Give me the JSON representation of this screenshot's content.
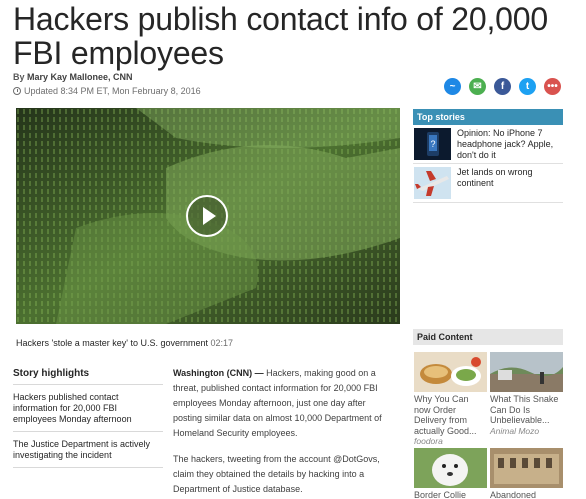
{
  "article": {
    "headline": "Hackers publish contact info of 20,000 FBI employees",
    "byline_prefix": "By ",
    "author": "Mary Kay Mallonee, CNN",
    "updated": "Updated 8:34 PM ET, Mon February 8, 2016"
  },
  "share": [
    {
      "icon": "messenger-icon",
      "glyph": "~",
      "color": "#1e88e5"
    },
    {
      "icon": "email-icon",
      "glyph": "✉",
      "color": "#4caf50"
    },
    {
      "icon": "facebook-icon",
      "glyph": "f",
      "color": "#3b5998"
    },
    {
      "icon": "twitter-icon",
      "glyph": "t",
      "color": "#1da1f2"
    },
    {
      "icon": "more-icon",
      "glyph": "•••",
      "color": "#d9534f"
    }
  ],
  "video": {
    "caption": "Hackers 'stole a master key' to U.S. government",
    "duration": "02:17"
  },
  "top_stories": {
    "header": "Top stories",
    "items": [
      {
        "text": "Opinion: No iPhone 7 headphone jack? Apple, don't do it"
      },
      {
        "text": "Jet lands on wrong continent"
      }
    ]
  },
  "paid": {
    "header": "Paid Content",
    "items": [
      {
        "title": "Why You Can now Order Delivery from actually Good...",
        "source": "foodora"
      },
      {
        "title": "What This Snake Can Do Is Unbelievable...",
        "source": "Animal Mozo"
      },
      {
        "title": "Border Collie",
        "source": ""
      },
      {
        "title": "Abandoned",
        "source": ""
      }
    ]
  },
  "highlights": {
    "title": "Story highlights",
    "items": [
      "Hackers published contact information for 20,000 FBI employees Monday afternoon",
      "The Justice Department is actively investigating the incident"
    ]
  },
  "body": {
    "dateline": "Washington (CNN) —",
    "p1": " Hackers, making good on a threat, published contact information for 20,000 FBI employees Monday afternoon, just one day after posting similar data on almost 10,000 Department of Homeland Security employees.",
    "p2": "The hackers, tweeting from the account @DotGovs, claim they obtained the details by hacking into a Department of Justice database."
  }
}
